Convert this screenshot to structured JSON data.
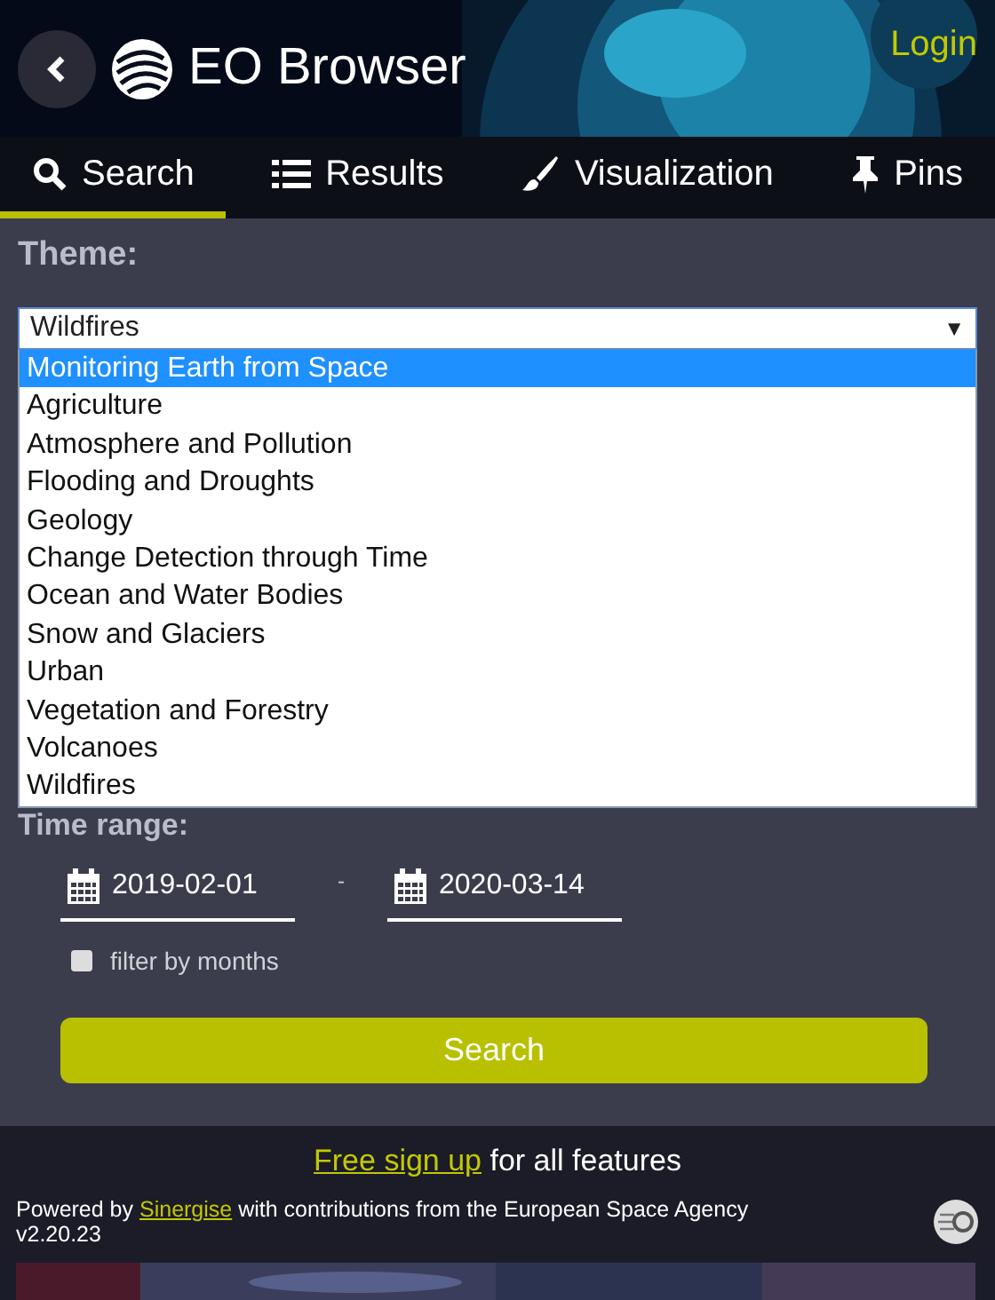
{
  "header": {
    "title": "EO Browser",
    "login": "Login"
  },
  "tabs": [
    {
      "label": "Search",
      "kind": "search",
      "selected": true
    },
    {
      "label": "Results",
      "kind": "list",
      "selected": false
    },
    {
      "label": "Visualization",
      "kind": "brush",
      "selected": false
    },
    {
      "label": "Pins",
      "kind": "pin",
      "selected": false
    }
  ],
  "theme": {
    "label": "Theme:",
    "value": "Wildfires",
    "arrow": "▼",
    "expanded": true,
    "options": [
      {
        "label": "Monitoring Earth from Space",
        "highlighted": true
      },
      {
        "label": "Agriculture",
        "highlighted": false
      },
      {
        "label": "Atmosphere and Pollution",
        "highlighted": false
      },
      {
        "label": "Flooding and Droughts",
        "highlighted": false
      },
      {
        "label": "Geology",
        "highlighted": false
      },
      {
        "label": "Change Detection through Time",
        "highlighted": false
      },
      {
        "label": "Ocean and Water Bodies",
        "highlighted": false
      },
      {
        "label": "Snow and Glaciers",
        "highlighted": false
      },
      {
        "label": "Urban",
        "highlighted": false
      },
      {
        "label": "Vegetation and Forestry",
        "highlighted": false
      },
      {
        "label": "Volcanoes",
        "highlighted": false
      },
      {
        "label": "Wildfires",
        "highlighted": false
      }
    ]
  },
  "time_range": {
    "label": "Time range:",
    "from": "2019-02-01",
    "separator": "-",
    "to": "2020-03-14",
    "filter_by_months": {
      "label": "filter by months",
      "checked": false
    }
  },
  "search_button": "Search",
  "footer": {
    "signup_link": "Free sign up",
    "signup_text": "for all features",
    "powered_by": "Powered by",
    "sinergise_link": "Sinergise",
    "contributions": "with contributions from the European Space Agency",
    "version": "v2.20.23"
  }
}
